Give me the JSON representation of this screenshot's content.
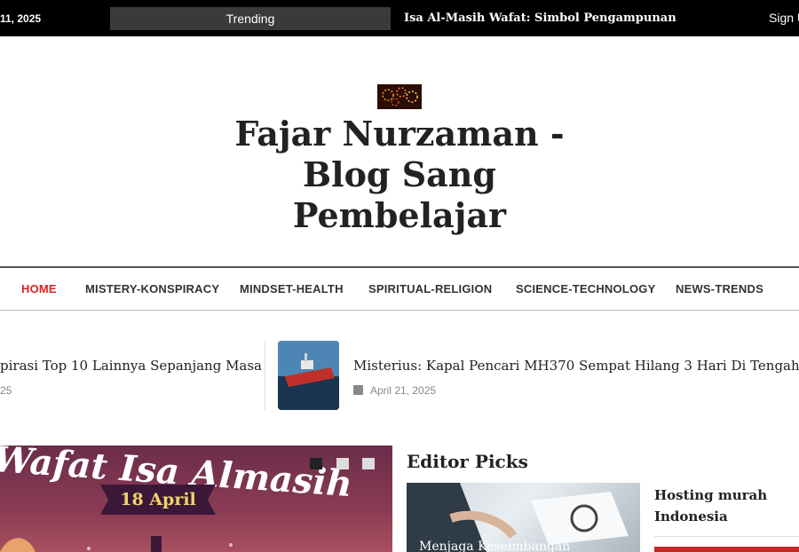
{
  "topbar": {
    "date": "11, 2025",
    "trending_label": "Trending",
    "ticker_headline": "Isa Al-Masih Wafat: Simbol Pengampunan",
    "signin_label": "Sign U"
  },
  "site": {
    "title": "Fajar Nurzaman - Blog Sang Pembelajar"
  },
  "nav": {
    "items": [
      {
        "label": "HOME"
      },
      {
        "label": "MISTERY-KONSPIRACY"
      },
      {
        "label": "MINDSET-HEALTH"
      },
      {
        "label": "SPIRITUAL-RELIGION"
      },
      {
        "label": "SCIENCE-TECHNOLOGY"
      },
      {
        "label": "NEWS-TRENDS"
      }
    ]
  },
  "carousel": {
    "posts": [
      {
        "title": "pirasi Top 10 Lainnya Sepanjang Masa",
        "date": "25"
      },
      {
        "title": "Misterius: Kapal Pencari MH370 Sempat Hilang 3 Hari Di Tengah La",
        "date": "April 21, 2025"
      }
    ]
  },
  "featured": {
    "headline": "Wafat Isa Almasih",
    "ribbon": "18 April"
  },
  "editor_picks": {
    "title": "Editor Picks",
    "main_caption": "Menjaga Keseimbangan",
    "side_title": "Hosting murah Indonesia"
  },
  "colors": {
    "topbar_bg": "#000000",
    "accent": "#dd2222",
    "trending_bg": "#3a3a3a"
  }
}
